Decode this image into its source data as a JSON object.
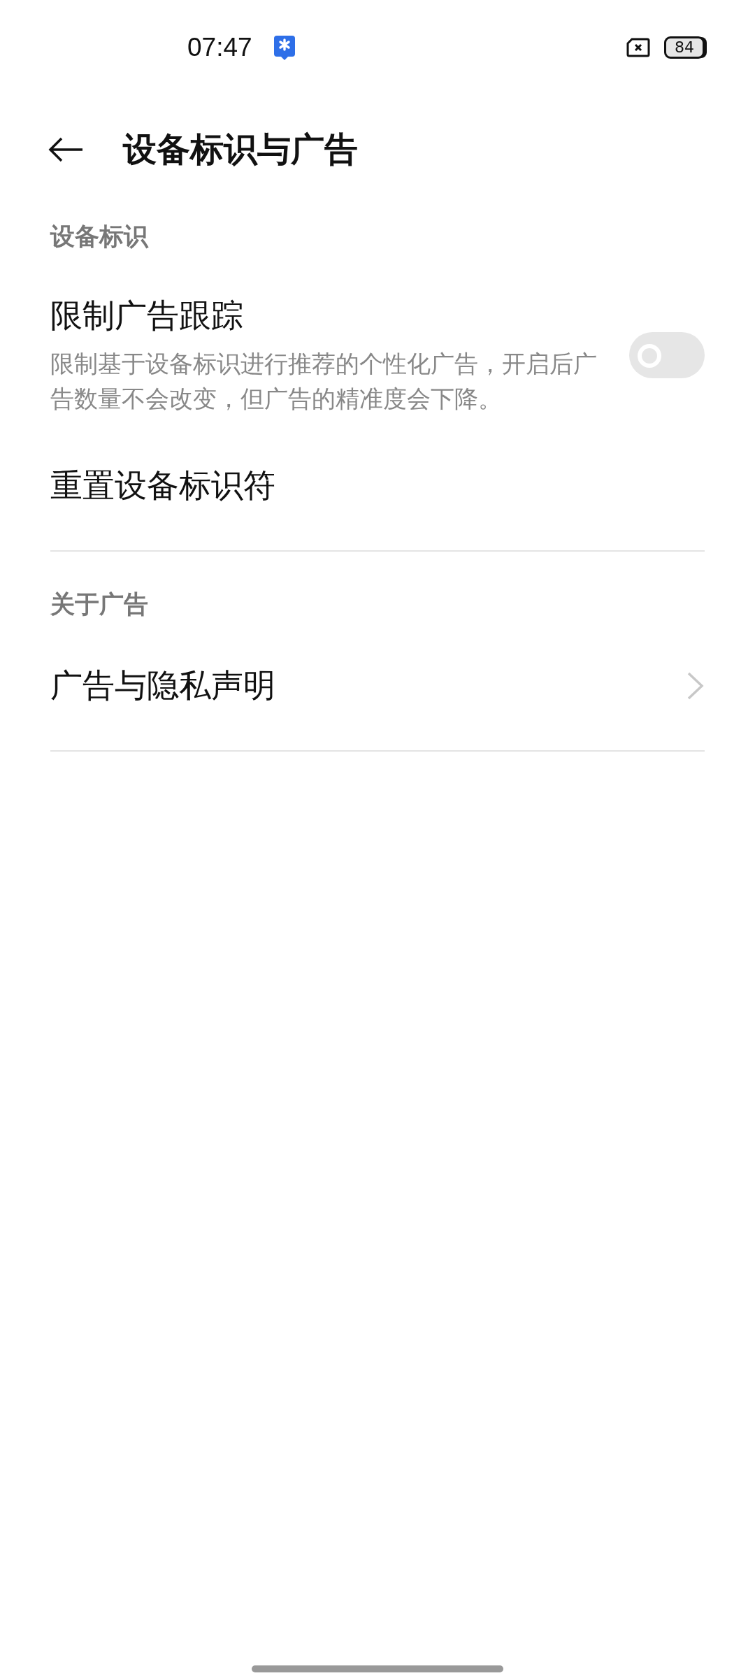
{
  "status_bar": {
    "time": "07:47",
    "battery": "84"
  },
  "header": {
    "title": "设备标识与广告"
  },
  "sections": [
    {
      "title": "设备标识",
      "divider": true,
      "items": [
        {
          "kind": "toggle",
          "title": "限制广告跟踪",
          "description": "限制基于设备标识进行推荐的个性化广告，开启后广告数量不会改变，但广告的精准度会下降。",
          "on": false
        },
        {
          "kind": "plain",
          "title": "重置设备标识符"
        }
      ]
    },
    {
      "title": "关于广告",
      "divider": true,
      "items": [
        {
          "kind": "link",
          "title": "广告与隐私声明"
        }
      ]
    }
  ]
}
